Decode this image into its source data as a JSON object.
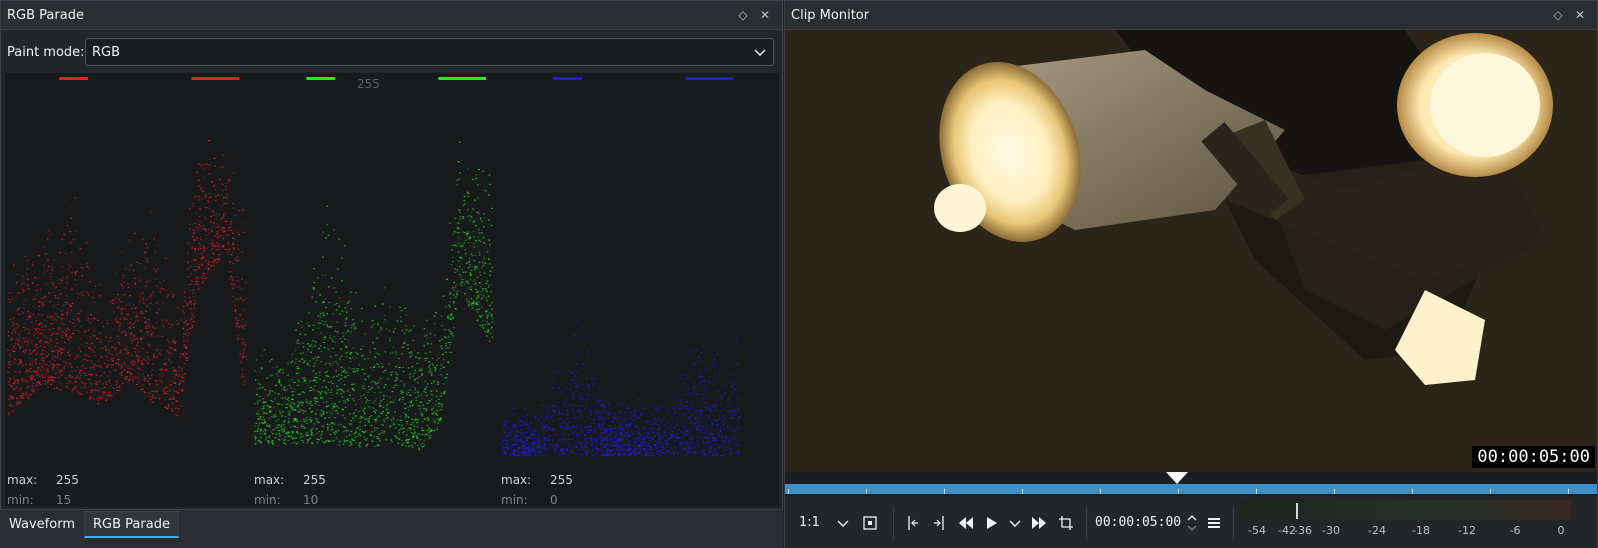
{
  "left_panel": {
    "title": "RGB Parade",
    "float_icon": "diamond-icon",
    "close_icon": "close-icon",
    "paint_mode_label": "Paint mode:",
    "paint_mode_value": "RGB",
    "scale_label": "255",
    "channels": [
      {
        "name": "red",
        "color": "#ff1a1a",
        "max_label": "max:",
        "max": "255",
        "min_label": "min:",
        "min": "15"
      },
      {
        "name": "green",
        "color": "#22ee22",
        "max_label": "max:",
        "max": "255",
        "min_label": "min:",
        "min": "10"
      },
      {
        "name": "blue",
        "color": "#1a1aff",
        "max_label": "max:",
        "max": "255",
        "min_label": "min:",
        "min": "0"
      }
    ]
  },
  "tabs": [
    {
      "label": "Waveform",
      "active": false
    },
    {
      "label": "RGB Parade",
      "active": true
    }
  ],
  "right_panel": {
    "title": "Clip Monitor",
    "float_icon": "diamond-icon",
    "close_icon": "close-icon",
    "video_timecode": "00:00:05:00",
    "position_percent": 50,
    "toolbar": {
      "zoom": "1:1",
      "timecode": "00:00:05:00",
      "icons": [
        "chevron-down-icon",
        "fit-frame-icon",
        "set-in-icon",
        "set-out-icon",
        "rewind-icon",
        "play-icon",
        "play-options-icon",
        "fast-forward-icon",
        "crop-icon",
        "timecode-spinner-icon",
        "menu-icon"
      ]
    },
    "audio_meter": {
      "labels": [
        "-54",
        "-42",
        "-36",
        "-30",
        "-24",
        "-18",
        "-12",
        "-6",
        "0"
      ]
    }
  },
  "colors": {
    "accent": "#3daee9",
    "ruler": "#3d8fc4",
    "panel_bg": "#232629"
  }
}
